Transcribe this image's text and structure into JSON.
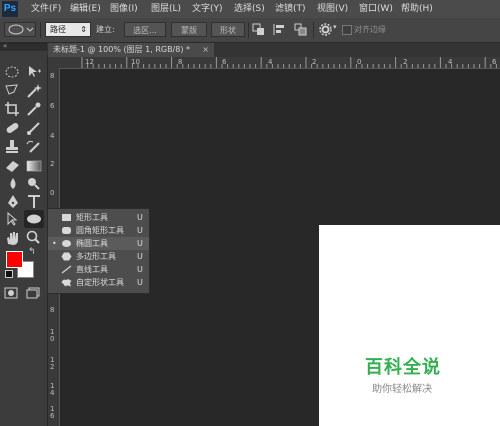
{
  "menubar": {
    "logo": "Ps",
    "items": [
      "文件(F)",
      "编辑(E)",
      "图像(I)",
      "图层(L)",
      "文字(Y)",
      "选择(S)",
      "滤镜(T)",
      "视图(V)",
      "窗口(W)",
      "帮助(H)"
    ]
  },
  "options": {
    "path_mode": "路径",
    "build_label": "建立:",
    "selection_btn": "选区...",
    "mask_btn": "蒙版",
    "shape_btn": "形状",
    "align_edges": "对齐边缘"
  },
  "document": {
    "tab_title": "未标题-1 @ 100% (图层 1, RGB/8) *",
    "close": "×"
  },
  "rulers": {
    "top_labels": [
      "12",
      "10",
      "8",
      "6",
      "4",
      "2",
      "0",
      "2",
      "4",
      "6"
    ],
    "left_labels": [
      "8",
      "6",
      "4",
      "2",
      "0",
      "2",
      "4",
      "6",
      "8",
      "1",
      "0",
      "1",
      "2",
      "1",
      "4",
      "1",
      "6",
      "1",
      "8"
    ]
  },
  "flyout": {
    "items": [
      {
        "label": "矩形工具",
        "key": "U",
        "icon": "rectangle-icon",
        "active": false
      },
      {
        "label": "圆角矩形工具",
        "key": "U",
        "icon": "rounded-rectangle-icon",
        "active": false
      },
      {
        "label": "椭圆工具",
        "key": "U",
        "icon": "ellipse-icon",
        "active": true
      },
      {
        "label": "多边形工具",
        "key": "U",
        "icon": "polygon-icon",
        "active": false
      },
      {
        "label": "直线工具",
        "key": "U",
        "icon": "line-icon",
        "active": false
      },
      {
        "label": "自定形状工具",
        "key": "U",
        "icon": "custom-shape-icon",
        "active": false
      }
    ],
    "active_bullet": "•"
  },
  "colors": {
    "foreground": "#ff0000",
    "background": "#ffffff",
    "accent": "#35b050"
  },
  "watermark": {
    "title": "百科全说",
    "subtitle": "助你轻松解决"
  }
}
